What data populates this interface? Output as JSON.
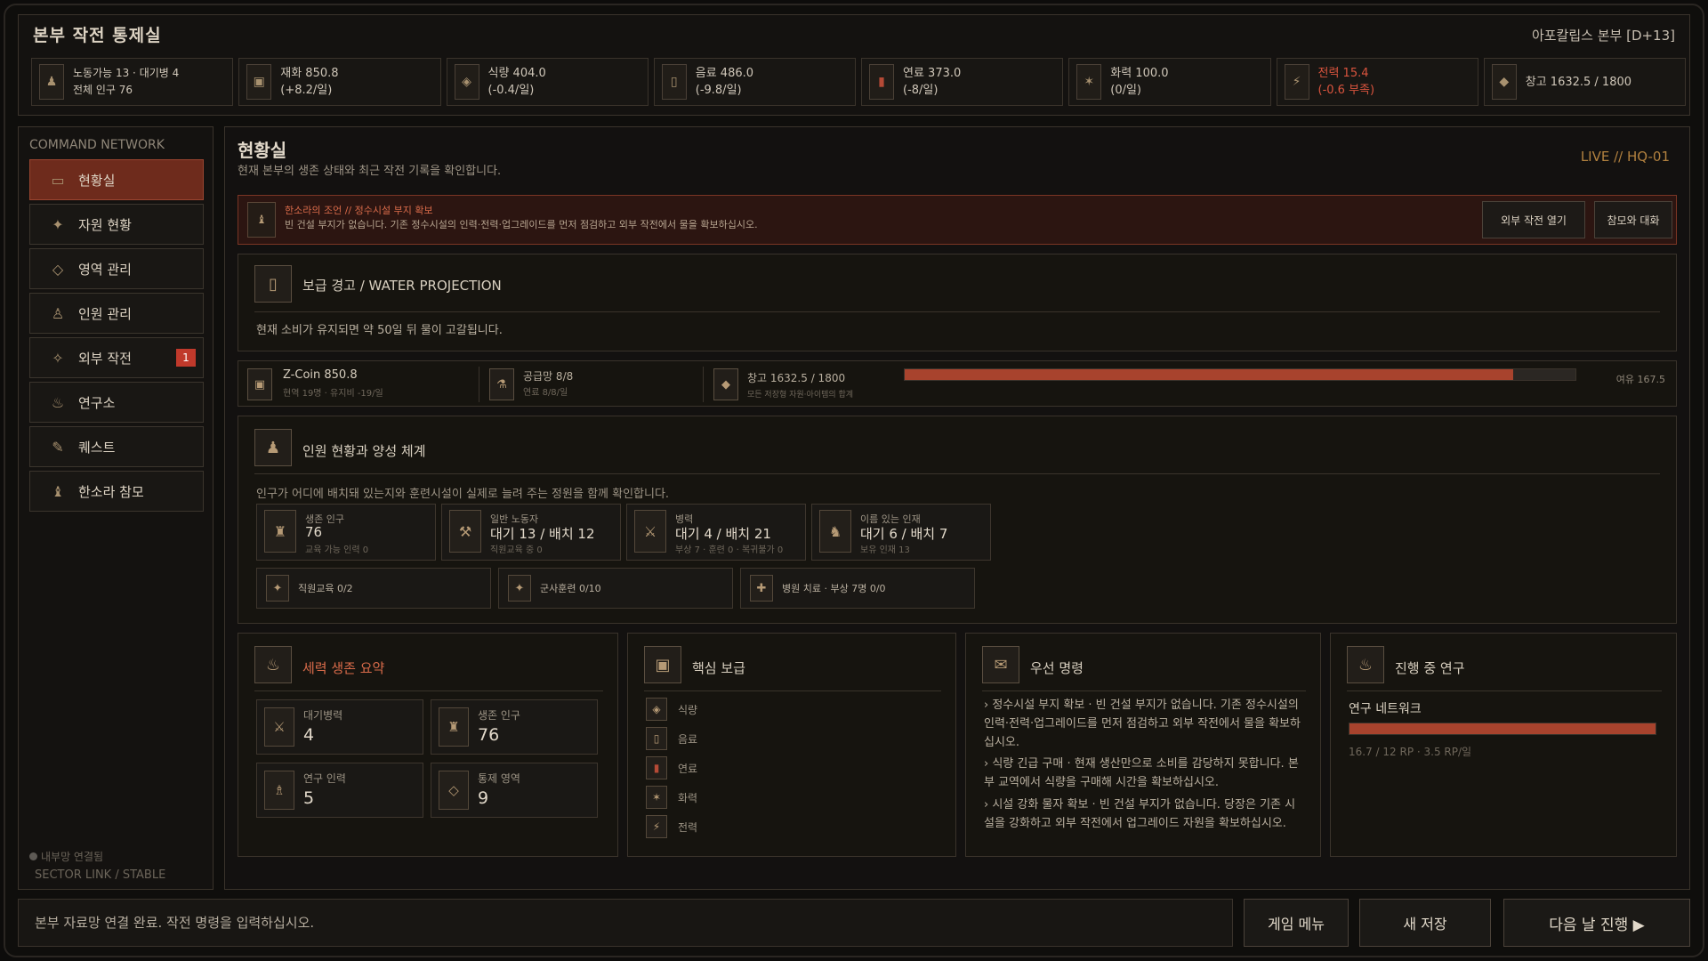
{
  "header": {
    "title": "본부 작전 통제실",
    "hq_label": "아포칼립스 본부 [D+13]",
    "resources": [
      {
        "icon": "workers-icon",
        "line1": "노동가능 13 · 대기병 4",
        "line2": "전체 인구 76",
        "warn": false
      },
      {
        "icon": "materials-icon",
        "line1": "재화 850.8",
        "line2": "(+8.2/일)",
        "warn": false
      },
      {
        "icon": "food-icon",
        "line1": "식량 404.0",
        "line2": "(-0.4/일)",
        "warn": false
      },
      {
        "icon": "water-icon",
        "line1": "음료 486.0",
        "line2": "(-9.8/일)",
        "warn": false
      },
      {
        "icon": "fuel-icon",
        "line1": "연료 373.0",
        "line2": "(-8/일)",
        "warn": false
      },
      {
        "icon": "firepower-icon",
        "line1": "화력 100.0",
        "line2": "(0/일)",
        "warn": false
      },
      {
        "icon": "power-icon",
        "line1": "전력 15.4",
        "line2": "(-0.6 부족)",
        "warn": true
      },
      {
        "icon": "storage-icon",
        "line1": "창고 1632.5 / 1800",
        "line2": "",
        "warn": false
      }
    ]
  },
  "sidebar": {
    "heading": "COMMAND NETWORK",
    "items": [
      {
        "label": "현황실",
        "icon": "status-room-icon",
        "active": true,
        "badge": ""
      },
      {
        "label": "자원 현황",
        "icon": "resources-icon",
        "active": false,
        "badge": ""
      },
      {
        "label": "영역 관리",
        "icon": "territory-icon",
        "active": false,
        "badge": ""
      },
      {
        "label": "인원 관리",
        "icon": "personnel-icon",
        "active": false,
        "badge": ""
      },
      {
        "label": "외부 작전",
        "icon": "operations-icon",
        "active": false,
        "badge": "1"
      },
      {
        "label": "연구소",
        "icon": "lab-icon",
        "active": false,
        "badge": ""
      },
      {
        "label": "퀘스트",
        "icon": "quest-icon",
        "active": false,
        "badge": ""
      },
      {
        "label": "한소라 참모",
        "icon": "advisor-icon",
        "active": false,
        "badge": ""
      }
    ],
    "status_line1": "내부망 연결됨",
    "status_line2": "SECTOR LINK / STABLE"
  },
  "main": {
    "title": "현황실",
    "subtitle": "현재 본부의 생존 상태와 최근 작전 기록을 확인합니다.",
    "live": "LIVE  //  HQ-01",
    "advisor": {
      "heading": "한소라의 조언  //  정수시설 부지 확보",
      "body": "빈 건설 부지가 없습니다. 기존 정수시설의 인력·전력·업그레이드를 먼저 점검하고 외부 작전에서 물을 확보하십시오.",
      "btn_ops": "외부 작전 열기",
      "btn_talk": "참모와 대화"
    },
    "warning": {
      "title": "보급 경고  /  WATER PROJECTION",
      "text": "현재 소비가 유지되면 약 50일 뒤 물이 고갈됩니다."
    },
    "economy": {
      "coin_title": "Z-Coin  850.8",
      "coin_sub": "현역 19명 · 유지비 -19/일",
      "supply_title": "공급망 8/8",
      "supply_sub": "연료 8/8/일",
      "storage_title": "창고  1632.5 / 1800",
      "storage_sub": "모든 저장형 자원·아이템의 합계",
      "storage_fill": 0.907,
      "margin": "여유 167.5"
    },
    "personnel": {
      "title": "인원 현황과 양성 체계",
      "desc": "인구가 어디에 배치돼 있는지와 훈련시설이 실제로 늘려 주는 정원을 함께 확인합니다.",
      "stats": [
        {
          "icon": "population-icon",
          "label": "생존 인구",
          "value": "76",
          "sub": "교육 가능 인력 0"
        },
        {
          "icon": "worker-icon",
          "label": "일반 노동자",
          "value": "대기 13 / 배치 12",
          "sub": "직원교육 중 0"
        },
        {
          "icon": "soldier-icon",
          "label": "병력",
          "value": "대기 4 / 배치 21",
          "sub": "부상 7 · 훈련 0 · 복귀불가 0"
        },
        {
          "icon": "talent-icon",
          "label": "이름 있는 인재",
          "value": "대기 6 / 배치 7",
          "sub": "보유 인재 13"
        }
      ],
      "training": [
        {
          "icon": "education-icon",
          "label": "직원교육  0/2"
        },
        {
          "icon": "military-training-icon",
          "label": "군사훈련  0/10"
        },
        {
          "icon": "hospital-icon",
          "label": "병원 치료 · 부상 7명  0/0"
        }
      ]
    },
    "summary": {
      "title": "세력 생존 요약",
      "boxes": [
        {
          "icon": "standby-troops-icon",
          "label": "대기병력",
          "value": "4"
        },
        {
          "icon": "population-icon",
          "label": "생존 인구",
          "value": "76"
        },
        {
          "icon": "researcher-icon",
          "label": "연구 인력",
          "value": "5"
        },
        {
          "icon": "territory-icon",
          "label": "통제 영역",
          "value": "9"
        }
      ]
    },
    "core_supply": {
      "title": "핵심 보급",
      "items": [
        {
          "icon": "food-icon",
          "label": "식량"
        },
        {
          "icon": "water-icon",
          "label": "음료"
        },
        {
          "icon": "fuel-icon",
          "label": "연료"
        },
        {
          "icon": "firepower-icon",
          "label": "화력"
        },
        {
          "icon": "power-icon",
          "label": "전력"
        }
      ]
    },
    "priority": {
      "title": "우선 명령",
      "orders": [
        "›  정수시설 부지 확보 · 빈 건설 부지가 없습니다. 기존 정수시설의 인력·전력·업그레이드를 먼저 점검하고 외부 작전에서 물을 확보하십시오.",
        "›  식량 긴급 구매 · 현재 생산만으로 소비를 감당하지 못합니다. 본부 교역에서 식량을 구매해 시간을 확보하십시오.",
        "›  시설 강화 물자 확보 · 빈 건설 부지가 없습니다. 당장은 기존 시설을 강화하고 외부 작전에서 업그레이드 자원을 확보하십시오."
      ]
    },
    "research": {
      "title": "진행 중 연구",
      "name": "연구 네트워크",
      "fill": 1.0,
      "meta": "16.7 / 12 RP  ·  3.5 RP/일"
    }
  },
  "footer": {
    "command_text": "본부 자료망 연결 완료. 작전 명령을 입력하십시오.",
    "menu_label": "게임 메뉴",
    "save_label": "새 저장",
    "next_day_label": "다음 날 진행 ▶"
  }
}
